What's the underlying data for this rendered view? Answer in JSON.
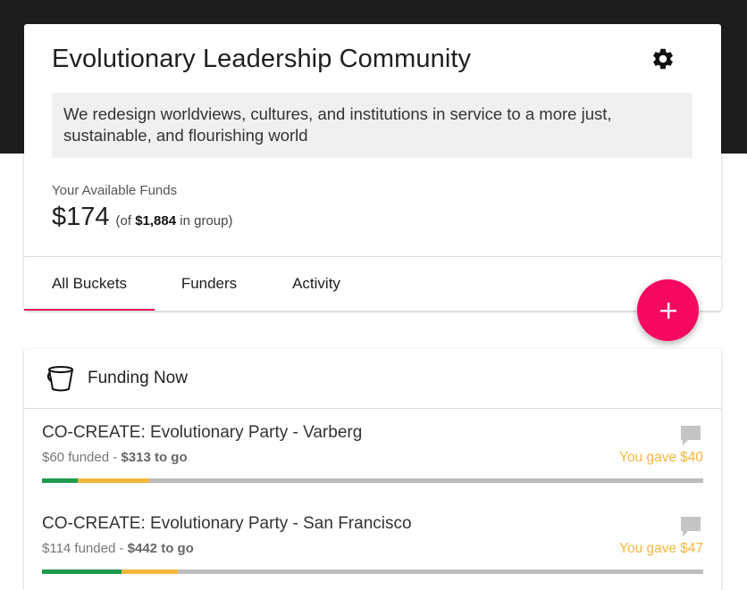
{
  "group": {
    "title": "Evolutionary Leadership Community",
    "description": "We redesign worldviews, cultures, and institutions in service to a more just, sustainable, and flourishing world",
    "funds_label": "Your Available Funds",
    "funds_amount": "$174",
    "funds_of_prefix": "(of",
    "group_total": "$1,884",
    "funds_of_suffix": "in group)",
    "settings_icon": "gear-icon"
  },
  "tabs": [
    {
      "label": "All Buckets",
      "active": true
    },
    {
      "label": "Funders",
      "active": false
    },
    {
      "label": "Activity",
      "active": false
    }
  ],
  "fab": {
    "label": "+",
    "icon": "plus-icon",
    "color": "#f5085f"
  },
  "funding_now": {
    "title": "Funding Now",
    "icon": "bucket-icon",
    "buckets": [
      {
        "title": "CO-CREATE: Evolutionary Party - Varberg",
        "funded": "$60 funded",
        "separator": " - ",
        "to_go": "$313 to go",
        "gave_prefix": "You gave",
        "gave_amount": "$40",
        "progress_funded": 0.054,
        "progress_pledged": 0.108
      },
      {
        "title": "CO-CREATE: Evolutionary Party - San Francisco",
        "funded": "$114 funded",
        "separator": " - ",
        "to_go": "$442 to go",
        "gave_prefix": "You gave",
        "gave_amount": "$47",
        "progress_funded": 0.12,
        "progress_pledged": 0.085
      }
    ]
  },
  "colors": {
    "accent": "#e5135d",
    "funded": "#1e9a4e",
    "pledged": "#f3b63d",
    "remaining": "#bdbdbd",
    "header_bg": "#1d1d1d"
  }
}
